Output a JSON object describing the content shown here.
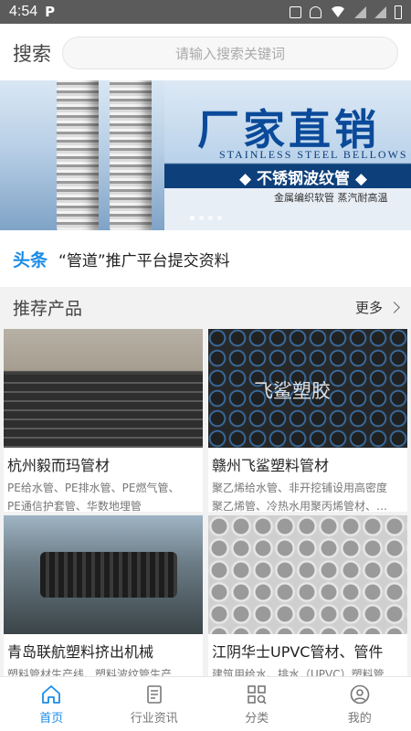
{
  "status_bar": {
    "time": "4:54",
    "app_badge": "P"
  },
  "search": {
    "label": "搜索",
    "placeholder": "请输入搜索关键词"
  },
  "banner": {
    "title": "厂家直销",
    "english": "STAINLESS STEEL BELLOWS",
    "product": "◆ 不锈钢波纹管 ◆",
    "subtitle": "金属编织软管 蒸汽耐高温",
    "dots": 4
  },
  "headline": {
    "tag": "头条",
    "text": "“管道”推广平台提交资料"
  },
  "section": {
    "title": "推荐产品",
    "more_label": "更多"
  },
  "products": [
    {
      "name": "杭州毅而玛管材",
      "desc1": "PE给水管、PE排水管、PE燃气管、",
      "desc2": "PE通信护套管、华数地埋管"
    },
    {
      "name": "赣州飞鲨塑料管材",
      "desc1": "聚乙烯给水管、非开挖铺设用高密度",
      "desc2": "聚乙烯管、冷热水用聚丙烯管材、…",
      "watermark": "飞鲨塑胶"
    },
    {
      "name": "青岛联航塑料挤出机械",
      "desc1": "塑料管材生产线、塑料波纹管生产"
    },
    {
      "name": "江阴华士UPVC管材、管件",
      "desc1": "建筑用给水、排水（UPVC）塑料管"
    }
  ],
  "tabs": [
    {
      "label": "首页",
      "icon": "home-icon",
      "active": true
    },
    {
      "label": "行业资讯",
      "icon": "news-icon",
      "active": false
    },
    {
      "label": "分类",
      "icon": "category-icon",
      "active": false
    },
    {
      "label": "我的",
      "icon": "profile-icon",
      "active": false
    }
  ],
  "colors": {
    "accent": "#1a8ce8",
    "status_bar": "#5b5b5b"
  }
}
